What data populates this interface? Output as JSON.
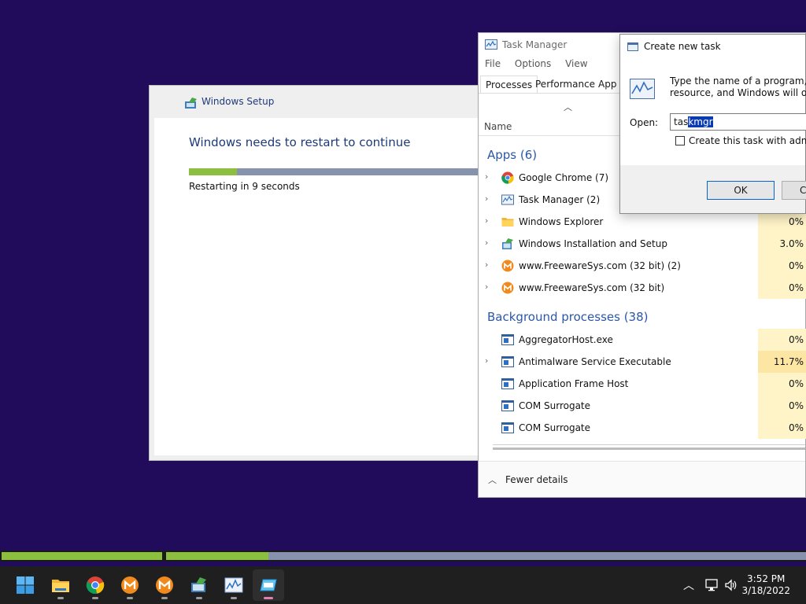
{
  "setup": {
    "title": "Windows Setup",
    "heading": "Windows needs to restart to continue",
    "progress_fraction": 0.16,
    "status": "Restarting in 9 seconds"
  },
  "task_manager": {
    "title": "Task Manager",
    "menu": [
      "File",
      "Options",
      "View"
    ],
    "tabs": [
      "Processes",
      "Performance",
      "App h"
    ],
    "active_tab": "Processes",
    "column_name": "Name",
    "apps_section": "Apps (6)",
    "apps": [
      {
        "label": "Google Chrome (7)",
        "icon": "chrome-icon",
        "cpu": "",
        "expandable": true
      },
      {
        "label": "Task Manager (2)",
        "icon": "task-manager-icon",
        "cpu": "",
        "expandable": true
      },
      {
        "label": "Windows Explorer",
        "icon": "folder-icon",
        "cpu": "0%",
        "expandable": true
      },
      {
        "label": "Windows Installation and Setup",
        "icon": "setup-icon",
        "cpu": "3.0%",
        "expandable": true
      },
      {
        "label": "www.FreewareSys.com (32 bit) (2)",
        "icon": "freewaresys-icon",
        "cpu": "0%",
        "expandable": true
      },
      {
        "label": "www.FreewareSys.com (32 bit)",
        "icon": "freewaresys-icon",
        "cpu": "0%",
        "expandable": true
      }
    ],
    "bg_section": "Background processes (38)",
    "background": [
      {
        "label": "AggregatorHost.exe",
        "icon": "process-icon",
        "cpu": "0%",
        "expandable": false
      },
      {
        "label": "Antimalware Service Executable",
        "icon": "process-icon",
        "cpu": "11.7%",
        "expandable": true
      },
      {
        "label": "Application Frame Host",
        "icon": "process-icon",
        "cpu": "0%",
        "expandable": false
      },
      {
        "label": "COM Surrogate",
        "icon": "process-icon",
        "cpu": "0%",
        "expandable": false
      },
      {
        "label": "COM Surrogate",
        "icon": "process-icon",
        "cpu": "0%",
        "expandable": false
      }
    ],
    "footer": "Fewer details"
  },
  "dialog": {
    "title": "Create new task",
    "description_line1": "Type the name of a program, fold",
    "description_line2": "resource, and Windows will open",
    "open_label": "Open:",
    "input_prefix": "tas",
    "input_selected": "kmgr",
    "checkbox_label": "Create this task with adminis",
    "ok": "OK",
    "cancel": "C"
  },
  "taskbar": {
    "setup_progress": [
      0.0,
      0.16
    ],
    "apps": [
      "start-icon",
      "file-explorer-icon",
      "chrome-icon",
      "freewaresys-icon",
      "freewaresys-icon",
      "setup-icon",
      "task-manager-icon",
      "run-dialog-icon"
    ],
    "time": "3:52 PM",
    "date": "3/18/2022"
  },
  "colors": {
    "desktop": "#200c5b",
    "progress_fill": "#8cbf3f",
    "progress_track": "#8793ad",
    "selection": "#0a3bb0",
    "section_heading": "#2a57a8"
  }
}
